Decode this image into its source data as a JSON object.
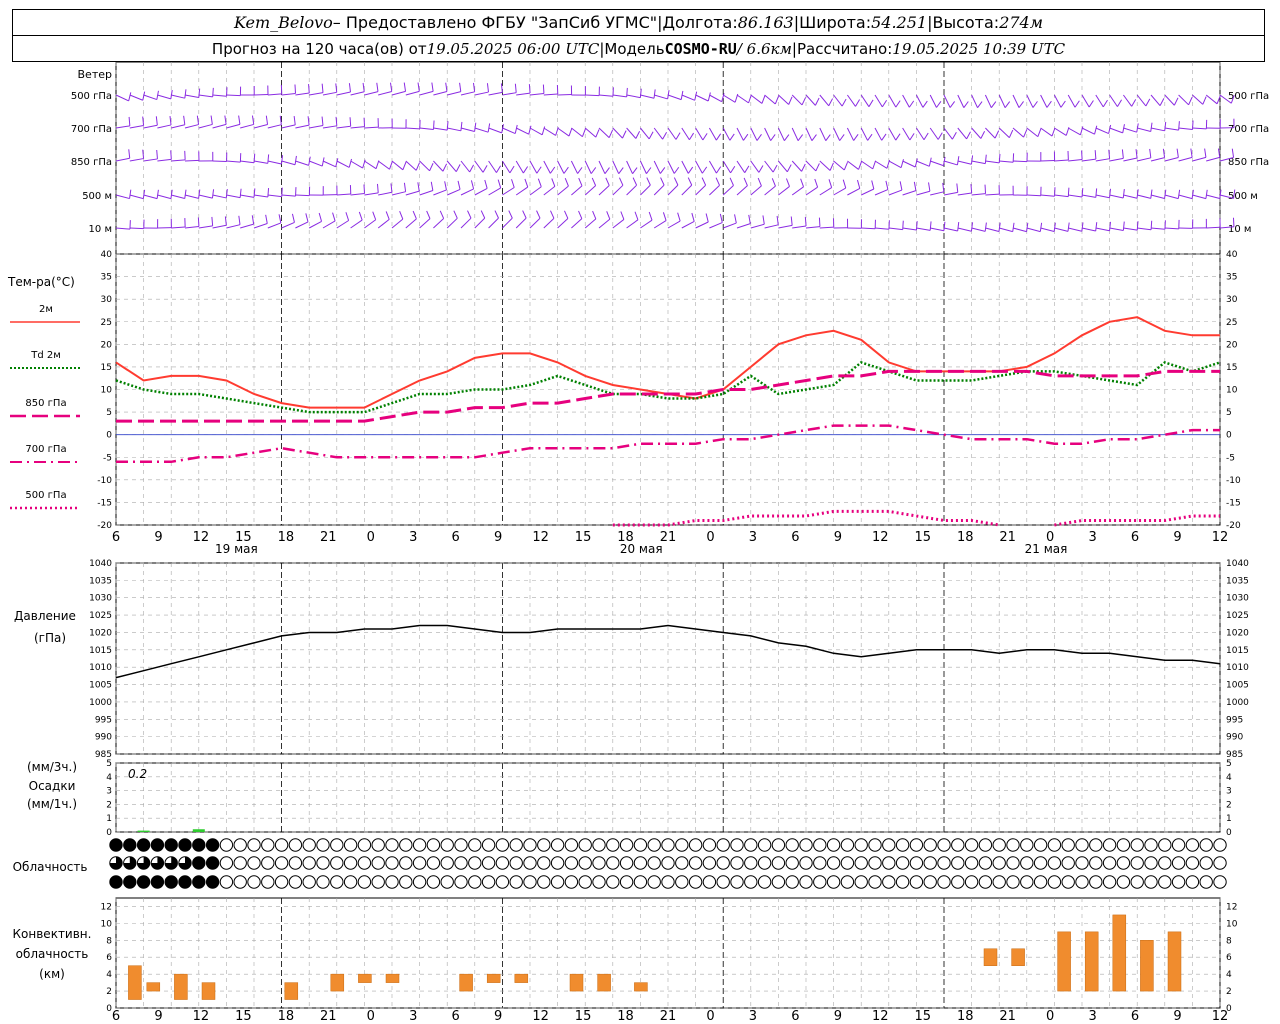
{
  "header": {
    "station": "Kem_Belovo",
    "provided": " – Предоставлено ФГБУ \"ЗапСиб УГМС\"",
    "sep": " | ",
    "lon_label": "Долгота: ",
    "lon": "86.163",
    "lat_label": "Широта: ",
    "lat": "54.251",
    "alt_label": "Высота: ",
    "alt": "274м",
    "forecast_label": "Прогноз на 120 часа(ов) от ",
    "forecast_time": "19.05.2025 06:00 UTC",
    "model_label": "Модель ",
    "model": "COSMO-RU",
    "model_res": " / 6.6км",
    "calc_label": "Рассчитано: ",
    "calc_time": "19.05.2025 10:39 UTC"
  },
  "wind": {
    "title": "Ветер",
    "levels": [
      "500 гПа",
      "700 гПа",
      "850 гПа",
      "500 м",
      "10  м"
    ],
    "color": "#8a2be2"
  },
  "temp_legend": {
    "title": "Тем-ра(°C)",
    "items": [
      {
        "label": "2м",
        "color": "#ff3b30",
        "style": "solid"
      },
      {
        "label": "Td  2м",
        "color": "#008000",
        "style": "dotted"
      },
      {
        "label": "850 гПа",
        "color": "#e6007e",
        "style": "dash"
      },
      {
        "label": "700 гПа",
        "color": "#e6007e",
        "style": "dashdot"
      },
      {
        "label": "500 гПа",
        "color": "#e6007e",
        "style": "dot"
      }
    ]
  },
  "pressure_panel": {
    "title1": "Давление",
    "title2": "(гПа)"
  },
  "precip_panel": {
    "title1": "(мм/3ч.)",
    "title2": "Осадки",
    "title3": "(мм/1ч.)",
    "annotation": "0.2"
  },
  "cloud_panel": {
    "title": "Облачность"
  },
  "conv_panel": {
    "title1": "Конвективн.",
    "title2": "облачность",
    "title3": "(км)"
  },
  "chart_data": {
    "type": "line",
    "x_hours": [
      0,
      3,
      6,
      9,
      12,
      15,
      18,
      21,
      24,
      27,
      30,
      33,
      36,
      39,
      42,
      45,
      48,
      51,
      54,
      57,
      60,
      63,
      66,
      69,
      72,
      75,
      78,
      81,
      84,
      87,
      90,
      93,
      96,
      99,
      102,
      105,
      108,
      111,
      114,
      117,
      120
    ],
    "x_tick_labels": [
      "6",
      "9",
      "12",
      "15",
      "18",
      "21",
      "0",
      "3",
      "6",
      "9",
      "12",
      "15",
      "18",
      "21",
      "0",
      "3",
      "6",
      "9",
      "12",
      "15",
      "18",
      "21",
      "0",
      "3",
      "6",
      "9",
      "12"
    ],
    "date_labels": [
      "19 мая",
      "20 мая",
      "21 мая"
    ],
    "temperature": {
      "ylim": [
        -20,
        40
      ],
      "yticks": [
        -20,
        -15,
        -10,
        -5,
        0,
        5,
        10,
        15,
        20,
        25,
        30,
        35,
        40
      ],
      "series": [
        {
          "name": "2м",
          "values": [
            16,
            12,
            13,
            13,
            12,
            9,
            7,
            6,
            6,
            6,
            9,
            12,
            14,
            17,
            18,
            18,
            16,
            13,
            11,
            10,
            9,
            8,
            10,
            15,
            20,
            22,
            23,
            21,
            16,
            14,
            14,
            14,
            14,
            15,
            18,
            22,
            25,
            26,
            23,
            22,
            22
          ]
        },
        {
          "name": "Td  2м",
          "values": [
            12,
            10,
            9,
            9,
            8,
            7,
            6,
            5,
            5,
            5,
            7,
            9,
            9,
            10,
            10,
            11,
            13,
            11,
            9,
            9,
            8,
            8,
            9,
            13,
            9,
            10,
            11,
            16,
            14,
            12,
            12,
            12,
            13,
            14,
            14,
            13,
            12,
            11,
            16,
            14,
            16
          ]
        },
        {
          "name": "850 гПа",
          "values": [
            3,
            3,
            3,
            3,
            3,
            3,
            3,
            3,
            3,
            3,
            4,
            5,
            5,
            6,
            6,
            7,
            7,
            8,
            9,
            9,
            9,
            9,
            10,
            10,
            11,
            12,
            13,
            13,
            14,
            14,
            14,
            14,
            14,
            14,
            13,
            13,
            13,
            13,
            14,
            14,
            14
          ]
        },
        {
          "name": "700 гПа",
          "values": [
            -6,
            -6,
            -6,
            -5,
            -5,
            -4,
            -3,
            -4,
            -5,
            -5,
            -5,
            -5,
            -5,
            -5,
            -4,
            -3,
            -3,
            -3,
            -3,
            -2,
            -2,
            -2,
            -1,
            -1,
            0,
            1,
            2,
            2,
            2,
            1,
            0,
            -1,
            -1,
            -1,
            -2,
            -2,
            -1,
            -1,
            0,
            1,
            1
          ]
        },
        {
          "name": "500 гПа",
          "values": [
            null,
            null,
            null,
            null,
            null,
            null,
            null,
            null,
            null,
            null,
            null,
            null,
            null,
            null,
            null,
            null,
            null,
            null,
            -20,
            -20,
            -20,
            -19,
            -19,
            -18,
            -18,
            -18,
            -17,
            -17,
            -17,
            -18,
            -19,
            -19,
            -20,
            null,
            -20,
            -19,
            -19,
            -19,
            -19,
            -18,
            -18
          ]
        }
      ]
    },
    "pressure": {
      "ylim": [
        985,
        1040
      ],
      "yticks": [
        985,
        990,
        995,
        1000,
        1005,
        1010,
        1015,
        1020,
        1025,
        1030,
        1035,
        1040
      ],
      "values": [
        1007,
        1009,
        1011,
        1013,
        1015,
        1017,
        1019,
        1020,
        1020,
        1021,
        1021,
        1022,
        1022,
        1021,
        1020,
        1020,
        1021,
        1021,
        1021,
        1021,
        1022,
        1021,
        1020,
        1019,
        1017,
        1016,
        1014,
        1013,
        1014,
        1015,
        1015,
        1015,
        1014,
        1015,
        1015,
        1014,
        1014,
        1013,
        1012,
        1012,
        1011
      ]
    },
    "precip": {
      "ylim": [
        0,
        5
      ],
      "yticks": [
        0,
        1,
        2,
        3,
        4,
        5
      ],
      "bars": [
        {
          "x": 3,
          "value": 0.1
        },
        {
          "x": 9,
          "value": 0.2
        }
      ]
    },
    "cloud_cover": {
      "note": "coverage values 0-4 per 3h step (row1 high, row2 medium, row3 low)",
      "row1": [
        4,
        4,
        4,
        4,
        0,
        0,
        0,
        0,
        0,
        0,
        0,
        0,
        0,
        0,
        0,
        0,
        0,
        0,
        0,
        0,
        0,
        0,
        0,
        0,
        0,
        0,
        0,
        0,
        0,
        0,
        0,
        0,
        0,
        0,
        0,
        0,
        0,
        0,
        0,
        0,
        0
      ],
      "row2": [
        3,
        3,
        3,
        4,
        0,
        0,
        0,
        0,
        0,
        0,
        0,
        0,
        0,
        0,
        0,
        0,
        0,
        0,
        0,
        0,
        0,
        0,
        0,
        0,
        0,
        0,
        0,
        0,
        0,
        0,
        0,
        0,
        0,
        0,
        0,
        0,
        0,
        0,
        0,
        0,
        0
      ],
      "row3": [
        4,
        4,
        4,
        4,
        0,
        0,
        0,
        0,
        0,
        0,
        0,
        0,
        0,
        0,
        0,
        0,
        0,
        0,
        0,
        0,
        0,
        0,
        0,
        0,
        0,
        0,
        0,
        0,
        0,
        0,
        0,
        0,
        0,
        0,
        0,
        0,
        0,
        0,
        0,
        0,
        0
      ]
    },
    "convective": {
      "ylim": [
        0,
        13
      ],
      "yticks": [
        0,
        2,
        4,
        6,
        8,
        10,
        12
      ],
      "bars": [
        {
          "x": 2,
          "base": 1,
          "top": 5
        },
        {
          "x": 4,
          "base": 2,
          "top": 3
        },
        {
          "x": 7,
          "base": 1,
          "top": 4
        },
        {
          "x": 10,
          "base": 1,
          "top": 3
        },
        {
          "x": 19,
          "base": 1,
          "top": 3
        },
        {
          "x": 24,
          "base": 2,
          "top": 4
        },
        {
          "x": 27,
          "base": 3,
          "top": 4
        },
        {
          "x": 30,
          "base": 3,
          "top": 4
        },
        {
          "x": 38,
          "base": 2,
          "top": 4
        },
        {
          "x": 41,
          "base": 3,
          "top": 4
        },
        {
          "x": 44,
          "base": 3,
          "top": 4
        },
        {
          "x": 47,
          "base": 3,
          "top": 3
        },
        {
          "x": 50,
          "base": 2,
          "top": 4
        },
        {
          "x": 53,
          "base": 2,
          "top": 4
        },
        {
          "x": 57,
          "base": 2,
          "top": 3
        },
        {
          "x": 95,
          "base": 5,
          "top": 7
        },
        {
          "x": 98,
          "base": 5,
          "top": 7
        },
        {
          "x": 103,
          "base": 2,
          "top": 9
        },
        {
          "x": 106,
          "base": 2,
          "top": 9
        },
        {
          "x": 109,
          "base": 2,
          "top": 11
        },
        {
          "x": 112,
          "base": 2,
          "top": 8
        },
        {
          "x": 115,
          "base": 2,
          "top": 9
        }
      ]
    }
  }
}
